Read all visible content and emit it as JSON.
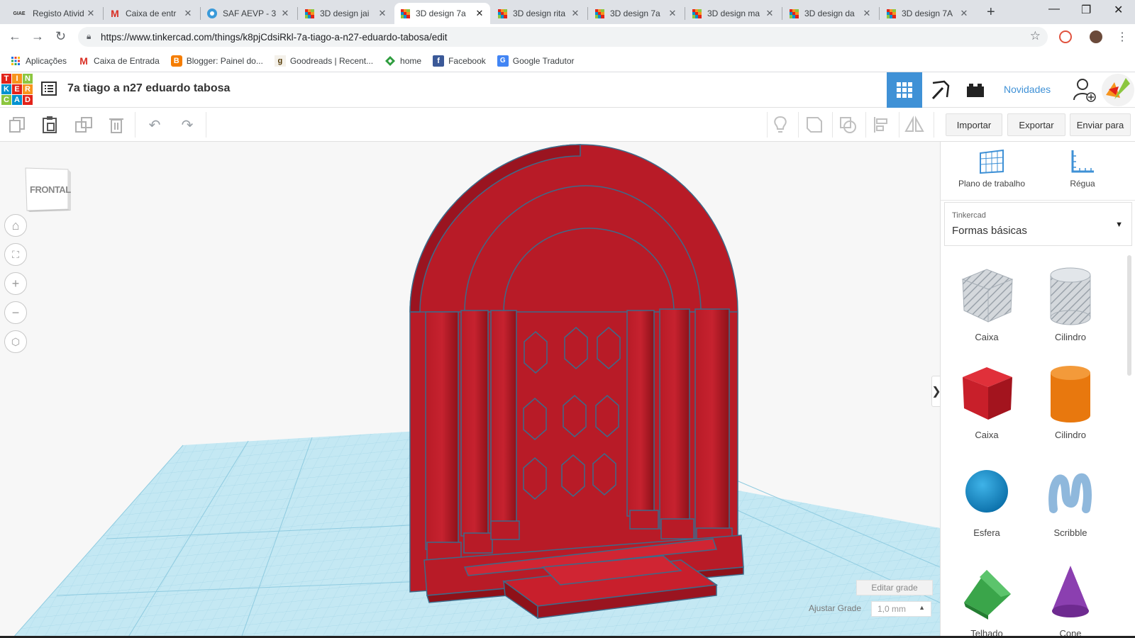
{
  "browser": {
    "tabs": [
      {
        "title": "Registo Ativid",
        "favicon": "giae-icon",
        "active": false
      },
      {
        "title": "Caixa de entr",
        "favicon": "gmail-icon",
        "active": false
      },
      {
        "title": "SAF AEVP - 3",
        "favicon": "saf-icon",
        "active": false
      },
      {
        "title": "3D design jai",
        "favicon": "tinkercad-icon",
        "active": false
      },
      {
        "title": "3D design 7a",
        "favicon": "tinkercad-icon",
        "active": true
      },
      {
        "title": "3D design rita",
        "favicon": "tinkercad-icon",
        "active": false
      },
      {
        "title": "3D design 7a",
        "favicon": "tinkercad-icon",
        "active": false
      },
      {
        "title": "3D design ma",
        "favicon": "tinkercad-icon",
        "active": false
      },
      {
        "title": "3D design da",
        "favicon": "tinkercad-icon",
        "active": false
      },
      {
        "title": "3D design 7A",
        "favicon": "tinkercad-icon",
        "active": false
      }
    ],
    "favicon_text": {
      "giae": "GIAE",
      "gmail": "M"
    },
    "url": "https://www.tinkercad.com/things/k8pjCdsiRkl-7a-tiago-a-n27-eduardo-tabosa/edit",
    "bookmarks": [
      {
        "label": "Aplicações",
        "icon": "apps-grid-icon"
      },
      {
        "label": "Caixa de Entrada",
        "icon": "gmail-icon"
      },
      {
        "label": "Blogger: Painel do...",
        "icon": "blogger-icon"
      },
      {
        "label": "Goodreads | Recent...",
        "icon": "goodreads-icon"
      },
      {
        "label": "home",
        "icon": "home-diamond-icon"
      },
      {
        "label": "Facebook",
        "icon": "facebook-icon"
      },
      {
        "label": "Google Tradutor",
        "icon": "google-translate-icon"
      }
    ],
    "bookmark_icon_text": {
      "gmail": "M",
      "blogger": "B",
      "goodreads": "g",
      "facebook": "f",
      "translate": "G"
    }
  },
  "app": {
    "logo_letters": [
      "T",
      "I",
      "N",
      "K",
      "E",
      "R",
      "C",
      "A",
      "D"
    ],
    "design_title": "7a tiago a n27 eduardo tabosa",
    "novidades": "Novidades",
    "toolbar": {
      "import": "Importar",
      "export": "Exportar",
      "send_to": "Enviar para"
    },
    "viewcube_label": "FRONTAL",
    "edit_grid": "Editar grade",
    "snap_label": "Ajustar Grade",
    "snap_value": "1,0 mm",
    "panel": {
      "workplane": "Plano de trabalho",
      "ruler": "Régua",
      "library_source": "Tinkercad",
      "library_name": "Formas básicas",
      "shapes": [
        {
          "label": "Caixa",
          "icon": "box-hole-icon"
        },
        {
          "label": "Cilindro",
          "icon": "cylinder-hole-icon"
        },
        {
          "label": "Caixa",
          "icon": "box-red-icon"
        },
        {
          "label": "Cilindro",
          "icon": "cylinder-orange-icon"
        },
        {
          "label": "Esfera",
          "icon": "sphere-icon"
        },
        {
          "label": "Scribble",
          "icon": "scribble-icon"
        },
        {
          "label": "Telhado",
          "icon": "roof-icon"
        },
        {
          "label": "Cone",
          "icon": "cone-icon"
        }
      ]
    }
  },
  "colors": {
    "accent": "#3f91d6",
    "model_red": "#b81b27",
    "grid_blue": "#bfe6f2",
    "tk_red": "#e2231a",
    "tk_orange": "#f7941d",
    "tk_green": "#8cc63f",
    "tk_blue": "#0092d0"
  }
}
